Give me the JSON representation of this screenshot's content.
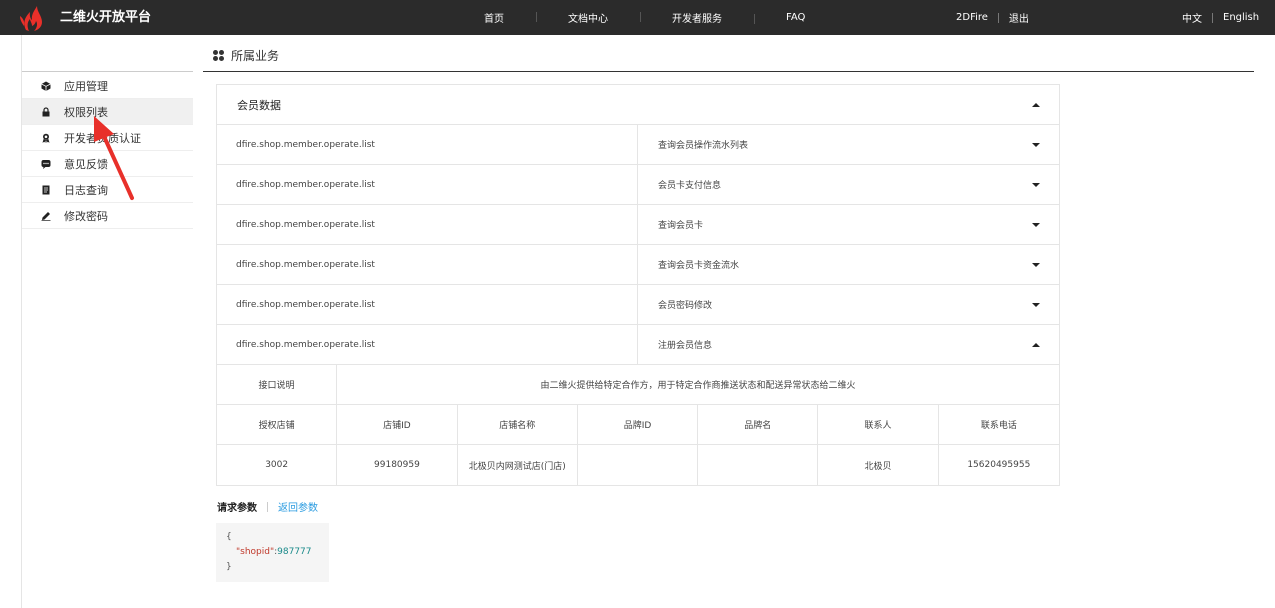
{
  "header": {
    "brand": "二维火开放平台",
    "nav": [
      {
        "label": "首页"
      },
      {
        "label": "文档中心"
      },
      {
        "label": "开发者服务"
      },
      {
        "label": "FAQ"
      }
    ],
    "user": "2DFire",
    "logout": "退出",
    "lang_zh": "中文",
    "lang_en": "English"
  },
  "sidebar": {
    "items": [
      {
        "label": "应用管理",
        "icon": "cube-icon"
      },
      {
        "label": "权限列表",
        "icon": "lock-icon"
      },
      {
        "label": "开发者资质认证",
        "icon": "badge-icon"
      },
      {
        "label": "意见反馈",
        "icon": "chat-icon"
      },
      {
        "label": "日志查询",
        "icon": "document-icon"
      },
      {
        "label": "修改密码",
        "icon": "pencil-icon"
      }
    ],
    "active_index": 1
  },
  "section": {
    "title": "所属业务"
  },
  "panel": {
    "title": "会员数据",
    "rows": [
      {
        "api": "dfire.shop.member.operate.list",
        "desc": "查询会员操作流水列表",
        "expanded": false
      },
      {
        "api": "dfire.shop.member.operate.list",
        "desc": "会员卡支付信息",
        "expanded": false
      },
      {
        "api": "dfire.shop.member.operate.list",
        "desc": "查询会员卡",
        "expanded": false
      },
      {
        "api": "dfire.shop.member.operate.list",
        "desc": "查询会员卡资金流水",
        "expanded": false
      },
      {
        "api": "dfire.shop.member.operate.list",
        "desc": "会员密码修改",
        "expanded": false
      },
      {
        "api": "dfire.shop.member.operate.list",
        "desc": "注册会员信息",
        "expanded": true
      }
    ],
    "detail": {
      "desc_label": "接口说明",
      "desc_value": "由二维火提供给特定合作方，用于特定合作商推送状态和配送异常状态给二维火",
      "columns": [
        "授权店铺",
        "店铺ID",
        "店铺名称",
        "品牌ID",
        "品牌名",
        "联系人",
        "联系电话"
      ],
      "values": [
        "3002",
        "99180959",
        "北极贝内网测试店(门店)",
        "",
        "",
        "北极贝",
        "15620495955"
      ]
    }
  },
  "params": {
    "tab_request": "请求参数",
    "tab_response": "返回参数",
    "code_open": "{",
    "code_key": "\"shopid\"",
    "code_colon": ":",
    "code_value": "987777",
    "code_close": "}"
  },
  "colors": {
    "topbar": "#2b2b2b",
    "link": "#2a9be0",
    "annotation": "#e8302a"
  }
}
